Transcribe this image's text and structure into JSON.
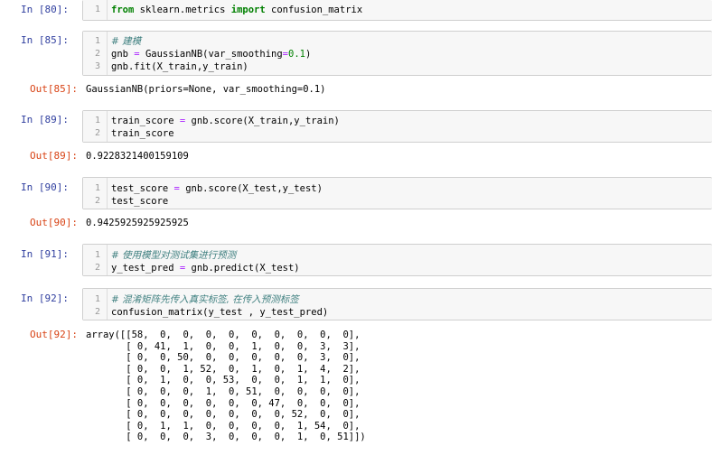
{
  "cells": {
    "c80": {
      "prompt": "In  [80]:",
      "lines": [
        {
          "no": "1",
          "kw1": "from",
          "t1": " sklearn.metrics ",
          "kw2": "import",
          "t2": " confusion_matrix"
        }
      ]
    },
    "c85": {
      "prompt": "In  [85]:",
      "line1": {
        "no": "1",
        "comment": "# 建模"
      },
      "line2": {
        "no": "2",
        "a": "gnb ",
        "eq": "=",
        "b": " GaussianNB(var_smoothing",
        "eq2": "=",
        "num": "0.1",
        "c": ")"
      },
      "line3": {
        "no": "3",
        "text": "gnb.fit(X_train,y_train)"
      },
      "out_prompt": "Out[85]:",
      "output": "GaussianNB(priors=None, var_smoothing=0.1)"
    },
    "c89": {
      "prompt": "In  [89]:",
      "line1": {
        "no": "1",
        "a": "train_score ",
        "eq": "=",
        "b": " gnb.score(X_train,y_train)"
      },
      "line2": {
        "no": "2",
        "text": "train_score"
      },
      "out_prompt": "Out[89]:",
      "output": "0.9228321400159109"
    },
    "c90": {
      "prompt": "In  [90]:",
      "line1": {
        "no": "1",
        "a": "test_score ",
        "eq": "=",
        "b": " gnb.score(X_test,y_test)"
      },
      "line2": {
        "no": "2",
        "text": "test_score"
      },
      "out_prompt": "Out[90]:",
      "output": "0.9425925925925925"
    },
    "c91": {
      "prompt": "In  [91]:",
      "line1": {
        "no": "1",
        "comment": "# 使用模型对测试集进行预测"
      },
      "line2": {
        "no": "2",
        "a": "y_test_pred ",
        "eq": "=",
        "b": " gnb.predict(X_test)"
      }
    },
    "c92": {
      "prompt": "In  [92]:",
      "line1": {
        "no": "1",
        "comment": "# 混淆矩阵先传入真实标签, 在传入预测标签"
      },
      "line2": {
        "no": "2",
        "text": "confusion_matrix(y_test , y_test_pred)"
      },
      "out_prompt": "Out[92]:",
      "array_lines": [
        "array([[58,  0,  0,  0,  0,  0,  0,  0,  0,  0],",
        "       [ 0, 41,  1,  0,  0,  1,  0,  0,  3,  3],",
        "       [ 0,  0, 50,  0,  0,  0,  0,  0,  3,  0],",
        "       [ 0,  0,  1, 52,  0,  1,  0,  1,  4,  2],",
        "       [ 0,  1,  0,  0, 53,  0,  0,  1,  1,  0],",
        "       [ 0,  0,  0,  1,  0, 51,  0,  0,  0,  0],",
        "       [ 0,  0,  0,  0,  0,  0, 47,  0,  0,  0],",
        "       [ 0,  0,  0,  0,  0,  0,  0, 52,  0,  0],",
        "       [ 0,  1,  1,  0,  0,  0,  0,  1, 54,  0],",
        "       [ 0,  0,  0,  3,  0,  0,  0,  1,  0, 51]])"
      ]
    }
  }
}
